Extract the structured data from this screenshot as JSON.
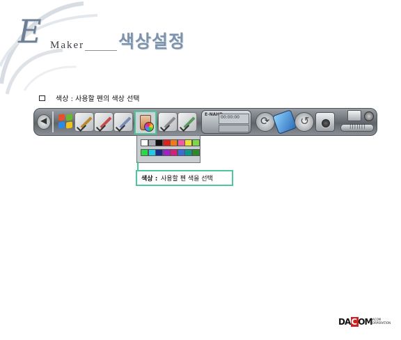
{
  "header": {
    "logo_letter": "E",
    "logo_word": "Maker",
    "title": "색상설정"
  },
  "description": {
    "bullet_text": "색상 : 사용할 펜의 색상 선택"
  },
  "toolbar": {
    "player": {
      "logo": "E-NAHP",
      "time": "00:00:00"
    },
    "volume_label": "|||||||"
  },
  "palette": {
    "row1": [
      "#ffffff",
      "#a8aeb4",
      "#111111",
      "#e02020",
      "#f07a1a",
      "#f05aa0",
      "#e8e230",
      "#78d848"
    ],
    "row2": [
      "#2ad84a",
      "#22c8e8",
      "#1a2a8a",
      "#a020c8",
      "#d02080",
      "#3a6cd8",
      "#0a9a8a",
      "#2a8a2a"
    ]
  },
  "callout": {
    "label": "색상 :",
    "text": "사용할 펜 색을 선택"
  },
  "brand": {
    "name_left": "DA",
    "name_right": "COM",
    "sub": "DACOM CORPORATION"
  }
}
